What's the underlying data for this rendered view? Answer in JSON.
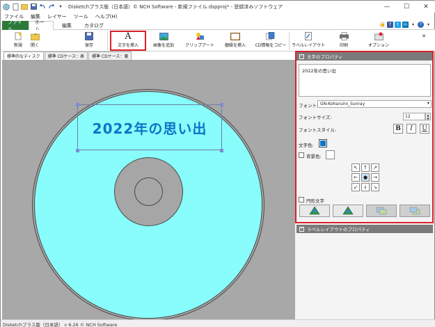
{
  "window": {
    "title": "Disketchプラス版（日本語）© NCH Software - 新規ファイル.dspproj* - 登録済みソフトウェア",
    "minimize": "—",
    "maximize": "☐",
    "close": "✕"
  },
  "menu": [
    "ファイル",
    "編集",
    "レイヤー",
    "ツール",
    "ヘルプ(H)"
  ],
  "ribbon_tabs": {
    "file": "ファイル",
    "home": "ホーム",
    "edit": "編集",
    "catalog": "カタログ"
  },
  "toolbar": {
    "new": "新規",
    "open": "開く",
    "save": "保存",
    "insert_text": "文字を挿入",
    "add_image": "画像を追加",
    "clipart": "クリップアート",
    "insert_frame": "額縁を挿入",
    "copy_cd_info": "CD情報をコピー",
    "label_layout": "ラベルレイアウト",
    "print": "印刷",
    "options": "オプション",
    "more": "»"
  },
  "document_tabs": [
    "標準的なディスク",
    "標準 CDケース：表",
    "標準 CDケース：裏"
  ],
  "canvas": {
    "disc_text": "2022年の思い出"
  },
  "text_properties": {
    "header": "文字のプロパティ",
    "collapse": "−",
    "text_value": "2022年の思い出",
    "font_label": "フォント:",
    "font_value": "GN-Koharuiro_Sunray",
    "font_size_label": "フォントサイズ:",
    "font_size_value": "12",
    "font_style_label": "フォントスタイル:",
    "bold": "B",
    "italic": "I",
    "underline": "U",
    "text_color_label": "文字色:",
    "text_color": "#0d74c7",
    "background_color_label": "背景色:",
    "background_color_checked": false,
    "circular_text_label": "円形文字",
    "circular_text_checked": false,
    "align": [
      "↖",
      "↑",
      "↗",
      "←",
      "●",
      "→",
      "↙",
      "↓",
      "↘"
    ]
  },
  "label_layout_properties": {
    "header": "ラベルレイアウトのプロパティ",
    "expand": "+"
  },
  "status_bar": {
    "text": "Disketchプラス版（日本語） v 6.26 © NCH Software"
  },
  "colors": {
    "disc_face": "#88fdfb",
    "disc_text": "#0d74c7",
    "highlight": "#d8202a",
    "file_tab": "#2c7a3a"
  }
}
